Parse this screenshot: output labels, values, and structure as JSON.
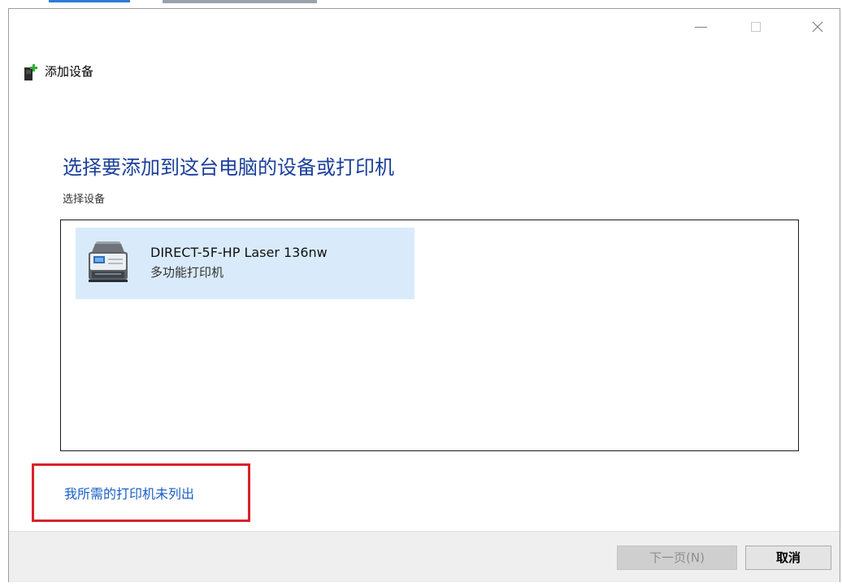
{
  "window": {
    "title": "添加设备"
  },
  "main": {
    "heading": "选择要添加到这台电脑的设备或打印机",
    "subheading": "选择设备",
    "devices": [
      {
        "name": "DIRECT-5F-HP Laser 136nw",
        "type": "多功能打印机",
        "selected": true
      }
    ]
  },
  "link": {
    "printer_not_listed": "我所需的打印机未列出"
  },
  "footer": {
    "next_label": "下一页(N)",
    "cancel_label": "取消"
  },
  "icons": {
    "app": "add-device-icon",
    "printer": "multifunction-printer-icon",
    "minimize": "minimize-icon",
    "maximize": "maximize-icon",
    "close": "close-icon"
  },
  "colors": {
    "heading": "#1b3f9b",
    "selected_item_bg": "#d9ebfa",
    "link": "#1a5fc7",
    "highlight_box": "#d9222a"
  }
}
